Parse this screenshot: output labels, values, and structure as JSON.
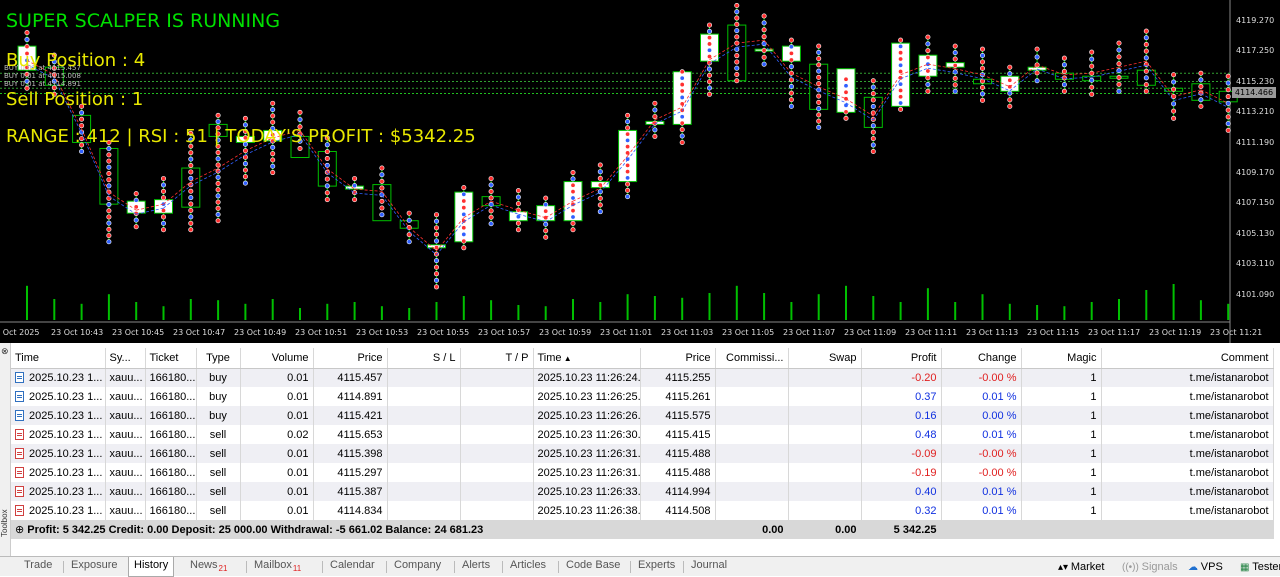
{
  "overlay": {
    "status": "SUPER SCALPER IS RUNNING",
    "buy_position": "Buy Position : 4",
    "sell_position": "Sell Position : 1",
    "stats": "RANGE : 412 | RSI : 51 | TODAY'S PROFIT : $5342.25"
  },
  "trade_lines": [
    "BUY 0.01 at 4115.457",
    "BUY 0.01 at 4115.008",
    "BUY 0.01 at 4114.891"
  ],
  "chart_data": {
    "type": "candlestick",
    "symbol": "xauusd",
    "y_ticks": [
      "4119.270",
      "4117.250",
      "4115.230",
      "4113.210",
      "4111.190",
      "4109.170",
      "4107.150",
      "4105.130",
      "4103.110",
      "4101.090"
    ],
    "y_range": [
      4100.2,
      4120.4
    ],
    "current_price": "4114.466",
    "x_ticks": [
      "23 Oct 2025",
      "23 Oct 10:43",
      "23 Oct 10:45",
      "23 Oct 10:47",
      "23 Oct 10:49",
      "23 Oct 10:51",
      "23 Oct 10:53",
      "23 Oct 10:55",
      "23 Oct 10:57",
      "23 Oct 10:59",
      "23 Oct 11:01",
      "23 Oct 11:03",
      "23 Oct 11:05",
      "23 Oct 11:07",
      "23 Oct 11:09",
      "23 Oct 11:11",
      "23 Oct 11:13",
      "23 Oct 11:15",
      "23 Oct 11:17",
      "23 Oct 11:19",
      "23 Oct 11:21"
    ],
    "candles": [
      [
        4116.0,
        4118.5,
        4114.8,
        4117.6
      ],
      [
        4116.2,
        4117.0,
        4114.4,
        4115.0
      ],
      [
        4113.0,
        4113.6,
        4110.6,
        4111.2
      ],
      [
        4110.8,
        4111.2,
        4104.6,
        4107.1
      ],
      [
        4106.5,
        4107.8,
        4105.6,
        4107.3
      ],
      [
        4106.5,
        4108.8,
        4105.4,
        4107.4
      ],
      [
        4109.5,
        4111.8,
        4105.4,
        4106.9
      ],
      [
        4112.4,
        4113.0,
        4106.0,
        4111.6
      ],
      [
        4111.2,
        4112.8,
        4108.5,
        4111.6
      ],
      [
        4111.3,
        4113.8,
        4109.2,
        4112.0
      ],
      [
        4111.6,
        4113.2,
        4110.8,
        4110.2
      ],
      [
        4110.6,
        4111.5,
        4107.4,
        4108.3
      ],
      [
        4108.1,
        4108.8,
        4107.4,
        4108.3
      ],
      [
        4108.4,
        4109.5,
        4106.4,
        4106.0
      ],
      [
        4106.0,
        4106.5,
        4104.6,
        4105.5
      ],
      [
        4104.2,
        4106.4,
        4101.6,
        4104.4
      ],
      [
        4104.6,
        4108.2,
        4104.2,
        4107.9
      ],
      [
        4107.6,
        4108.8,
        4105.8,
        4107.0
      ],
      [
        4106.0,
        4108.0,
        4105.4,
        4106.6
      ],
      [
        4106.0,
        4107.5,
        4104.9,
        4107.0
      ],
      [
        4106.0,
        4109.2,
        4105.4,
        4108.6
      ],
      [
        4108.2,
        4109.7,
        4106.6,
        4108.6
      ],
      [
        4108.6,
        4113.0,
        4107.6,
        4112.0
      ],
      [
        4112.4,
        4113.8,
        4111.6,
        4112.6
      ],
      [
        4112.4,
        4115.9,
        4111.2,
        4115.9
      ],
      [
        4116.6,
        4119.0,
        4114.4,
        4118.4
      ],
      [
        4119.0,
        4120.3,
        4115.3,
        4115.3
      ],
      [
        4117.4,
        4119.6,
        4116.4,
        4117.4
      ],
      [
        4116.6,
        4118.0,
        4113.6,
        4117.6
      ],
      [
        4116.4,
        4117.6,
        4112.2,
        4113.4
      ],
      [
        4113.2,
        4115.4,
        4112.8,
        4116.1
      ],
      [
        4114.2,
        4115.3,
        4110.6,
        4112.2
      ],
      [
        4113.6,
        4118.0,
        4113.4,
        4117.8
      ],
      [
        4115.6,
        4118.2,
        4114.6,
        4117.0
      ],
      [
        4116.2,
        4117.6,
        4114.6,
        4116.5
      ],
      [
        4115.4,
        4117.4,
        4114.0,
        4115.1
      ],
      [
        4114.6,
        4116.2,
        4113.6,
        4115.6
      ],
      [
        4116.0,
        4117.4,
        4115.3,
        4116.2
      ],
      [
        4115.8,
        4116.8,
        4114.6,
        4115.4
      ],
      [
        4115.6,
        4117.2,
        4114.4,
        4115.3
      ],
      [
        4115.6,
        4117.8,
        4114.6,
        4115.5
      ],
      [
        4116.0,
        4118.6,
        4114.6,
        4115.0
      ],
      [
        4114.8,
        4115.7,
        4112.8,
        4114.6
      ],
      [
        4115.1,
        4115.8,
        4113.6,
        4114.0
      ],
      [
        4114.6,
        4115.6,
        4112.0,
        4113.9
      ]
    ],
    "volumes": [
      0.57,
      0.35,
      0.27,
      0.43,
      0.3,
      0.23,
      0.35,
      0.33,
      0.27,
      0.35,
      0.2,
      0.27,
      0.3,
      0.23,
      0.2,
      0.3,
      0.4,
      0.33,
      0.25,
      0.23,
      0.35,
      0.3,
      0.43,
      0.4,
      0.37,
      0.45,
      0.57,
      0.45,
      0.3,
      0.43,
      0.57,
      0.4,
      0.3,
      0.53,
      0.3,
      0.43,
      0.27,
      0.25,
      0.23,
      0.3,
      0.35,
      0.5,
      0.6,
      0.33,
      0.27
    ]
  },
  "table": {
    "headers": [
      "Time",
      "Sy...",
      "Ticket",
      "Type",
      "Volume",
      "Price",
      "S / L",
      "T / P",
      "Time",
      "Price",
      "Commissi...",
      "Swap",
      "Profit",
      "Change",
      "Magic",
      "Comment"
    ],
    "rows": [
      [
        "2025.10.23 1...",
        "xauu...",
        "166180...",
        "buy",
        "0.01",
        "4115.457",
        "",
        "",
        "2025.10.23 11:26:24...",
        "4115.255",
        "",
        "",
        "-0.20",
        "-0.00 %",
        "1",
        "t.me/istanarobot"
      ],
      [
        "2025.10.23 1...",
        "xauu...",
        "166180...",
        "buy",
        "0.01",
        "4114.891",
        "",
        "",
        "2025.10.23 11:26:25...",
        "4115.261",
        "",
        "",
        "0.37",
        "0.01 %",
        "1",
        "t.me/istanarobot"
      ],
      [
        "2025.10.23 1...",
        "xauu...",
        "166180...",
        "buy",
        "0.01",
        "4115.421",
        "",
        "",
        "2025.10.23 11:26:26...",
        "4115.575",
        "",
        "",
        "0.16",
        "0.00 %",
        "1",
        "t.me/istanarobot"
      ],
      [
        "2025.10.23 1...",
        "xauu...",
        "166180...",
        "sell",
        "0.02",
        "4115.653",
        "",
        "",
        "2025.10.23 11:26:30...",
        "4115.415",
        "",
        "",
        "0.48",
        "0.01 %",
        "1",
        "t.me/istanarobot"
      ],
      [
        "2025.10.23 1...",
        "xauu...",
        "166180...",
        "sell",
        "0.01",
        "4115.398",
        "",
        "",
        "2025.10.23 11:26:31...",
        "4115.488",
        "",
        "",
        "-0.09",
        "-0.00 %",
        "1",
        "t.me/istanarobot"
      ],
      [
        "2025.10.23 1...",
        "xauu...",
        "166180...",
        "sell",
        "0.01",
        "4115.297",
        "",
        "",
        "2025.10.23 11:26:31...",
        "4115.488",
        "",
        "",
        "-0.19",
        "-0.00 %",
        "1",
        "t.me/istanarobot"
      ],
      [
        "2025.10.23 1...",
        "xauu...",
        "166180...",
        "sell",
        "0.01",
        "4115.387",
        "",
        "",
        "2025.10.23 11:26:33...",
        "4114.994",
        "",
        "",
        "0.40",
        "0.01 %",
        "1",
        "t.me/istanarobot"
      ],
      [
        "2025.10.23 1...",
        "xauu...",
        "166180...",
        "sell",
        "0.01",
        "4114.834",
        "",
        "",
        "2025.10.23 11:26:38...",
        "4114.508",
        "",
        "",
        "0.32",
        "0.01 %",
        "1",
        "t.me/istanarobot"
      ]
    ],
    "summary": {
      "text": "Profit: 5 342.25  Credit: 0.00  Deposit: 25 000.00  Withdrawal: -5 661.02  Balance: 24 681.23",
      "commission": "0.00",
      "swap": "0.00",
      "profit": "5 342.25"
    }
  },
  "toolbox_label": "Toolbox",
  "tabs": [
    {
      "label": "Trade",
      "badge": ""
    },
    {
      "label": "Exposure",
      "badge": ""
    },
    {
      "label": "History",
      "badge": "",
      "active": true
    },
    {
      "label": "News",
      "badge": "21"
    },
    {
      "label": "Mailbox",
      "badge": "11"
    },
    {
      "label": "Calendar",
      "badge": ""
    },
    {
      "label": "Company",
      "badge": ""
    },
    {
      "label": "Alerts",
      "badge": ""
    },
    {
      "label": "Articles",
      "badge": ""
    },
    {
      "label": "Code Base",
      "badge": ""
    },
    {
      "label": "Experts",
      "badge": ""
    },
    {
      "label": "Journal",
      "badge": ""
    }
  ],
  "right_status": {
    "market": "Market",
    "signals": "Signals",
    "vps": "VPS",
    "tester": "Tester"
  },
  "colors": {
    "bull_body": "#ffffff",
    "candle_border": "#00c000",
    "buy_marker": "#3060ff",
    "sell_marker": "#ff3030",
    "overlay_green": "#00e000",
    "overlay_yellow": "#e8e800"
  }
}
